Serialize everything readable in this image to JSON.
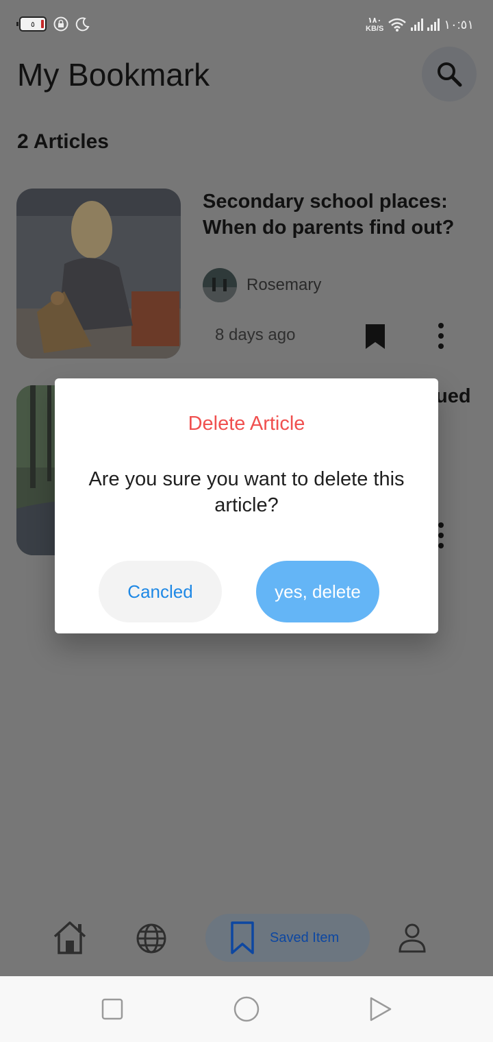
{
  "status_bar": {
    "battery_level": "٥",
    "net_speed_value": "١٨٠",
    "net_speed_unit": "KB/S",
    "time": "١٠:٥١"
  },
  "header": {
    "title": "My Bookmark"
  },
  "article_count": "2 Articles",
  "articles": [
    {
      "title": "Secondary school places: When do parents find out?",
      "author": "Rosemary",
      "time_ago": "8 days ago",
      "bookmarked": true
    },
    {
      "title_visible_fragment": "ued"
    }
  ],
  "bottom_nav": {
    "saved_label": "Saved Item",
    "items": [
      "home-icon",
      "globe-icon",
      "bookmark-icon",
      "profile-icon"
    ]
  },
  "dialog": {
    "title": "Delete Article",
    "message": "Are you sure you want to delete this article?",
    "cancel_label": "Cancled",
    "confirm_label": "yes, delete",
    "title_color": "#f0504f",
    "confirm_color": "#64b5f6",
    "cancel_text_color": "#1e88e5"
  }
}
